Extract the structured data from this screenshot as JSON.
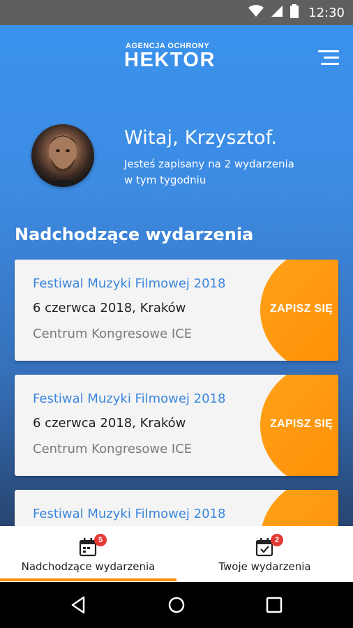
{
  "status_bar": {
    "time": "12:30",
    "icons": [
      "wifi-icon",
      "cell-signal-icon",
      "battery-icon"
    ]
  },
  "header": {
    "brand_top": "AGENCJA OCHRONY",
    "brand_main": "HEKTOR",
    "menu_icon": "hamburger-menu-icon"
  },
  "greeting": {
    "title": "Witaj, Krzysztof.",
    "line1": "Jesteś zapisany na 2 wydarzenia",
    "line2": "w tym tygodniu"
  },
  "section": {
    "title": "Nadchodzące wydarzenia"
  },
  "events": [
    {
      "title": "Festiwal Muzyki Filmowej 2018",
      "date": "6 czerwca 2018, Kraków",
      "place": "Centrum Kongresowe ICE",
      "cta": "ZAPISZ SIĘ"
    },
    {
      "title": "Festiwal Muzyki Filmowej 2018",
      "date": "6 czerwca 2018, Kraków",
      "place": "Centrum Kongresowe ICE",
      "cta": "ZAPISZ SIĘ"
    },
    {
      "title": "Festiwal Muzyki Filmowej 2018",
      "date": "",
      "place": "",
      "cta": ""
    }
  ],
  "bottom_nav": {
    "items": [
      {
        "label": "Nadchodzące wydarzenia",
        "badge": "5",
        "icon": "calendar-icon",
        "active": true
      },
      {
        "label": "Twoje wydarzenia",
        "badge": "2",
        "icon": "calendar-check-icon",
        "active": false
      }
    ]
  },
  "colors": {
    "accent": "#ff8a00",
    "link": "#3a86dd",
    "badge": "#e53935"
  }
}
